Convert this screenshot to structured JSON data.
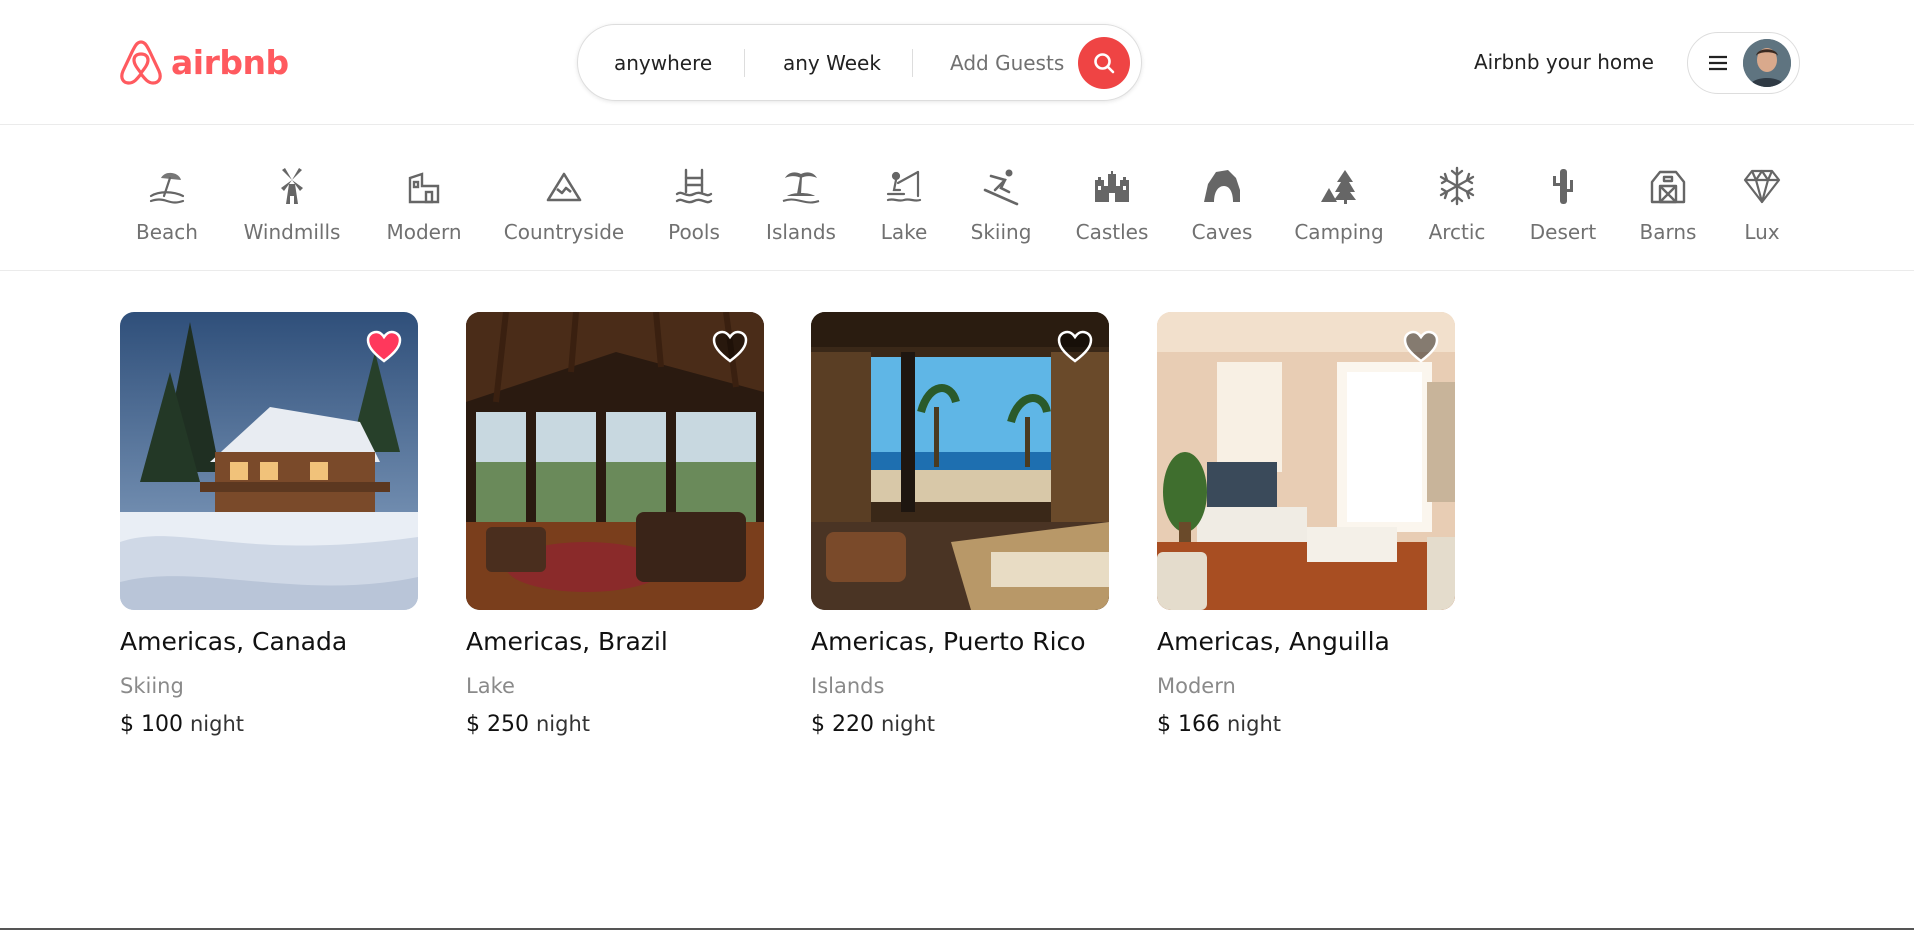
{
  "brand": {
    "name": "airbnb",
    "color": "#ff5a5f"
  },
  "search": {
    "where": "anywhere",
    "when": "any Week",
    "guests_placeholder": "Add Guests",
    "button_color": "#ef4444"
  },
  "header": {
    "host_link": "Airbnb your home"
  },
  "categories": [
    {
      "label": "Beach",
      "icon": "beach-icon"
    },
    {
      "label": "Windmills",
      "icon": "windmill-icon"
    },
    {
      "label": "Modern",
      "icon": "modern-house-icon"
    },
    {
      "label": "Countryside",
      "icon": "mountain-icon"
    },
    {
      "label": "Pools",
      "icon": "pool-icon"
    },
    {
      "label": "Islands",
      "icon": "island-icon"
    },
    {
      "label": "Lake",
      "icon": "lake-fishing-icon"
    },
    {
      "label": "Skiing",
      "icon": "skier-icon"
    },
    {
      "label": "Castles",
      "icon": "castle-icon"
    },
    {
      "label": "Caves",
      "icon": "cave-icon"
    },
    {
      "label": "Camping",
      "icon": "tent-tree-icon"
    },
    {
      "label": "Arctic",
      "icon": "snowflake-icon"
    },
    {
      "label": "Desert",
      "icon": "cactus-icon"
    },
    {
      "label": "Barns",
      "icon": "barn-icon"
    },
    {
      "label": "Lux",
      "icon": "diamond-icon"
    }
  ],
  "listings": [
    {
      "location": "Americas, Canada",
      "category": "Skiing",
      "price": "$ 100",
      "unit": "night",
      "favorited": true
    },
    {
      "location": "Americas, Brazil",
      "category": "Lake",
      "price": "$ 250",
      "unit": "night",
      "favorited": false
    },
    {
      "location": "Americas, Puerto Rico",
      "category": "Islands",
      "price": "$ 220",
      "unit": "night",
      "favorited": false
    },
    {
      "location": "Americas, Anguilla",
      "category": "Modern",
      "price": "$ 166",
      "unit": "night",
      "favorited": false
    }
  ]
}
